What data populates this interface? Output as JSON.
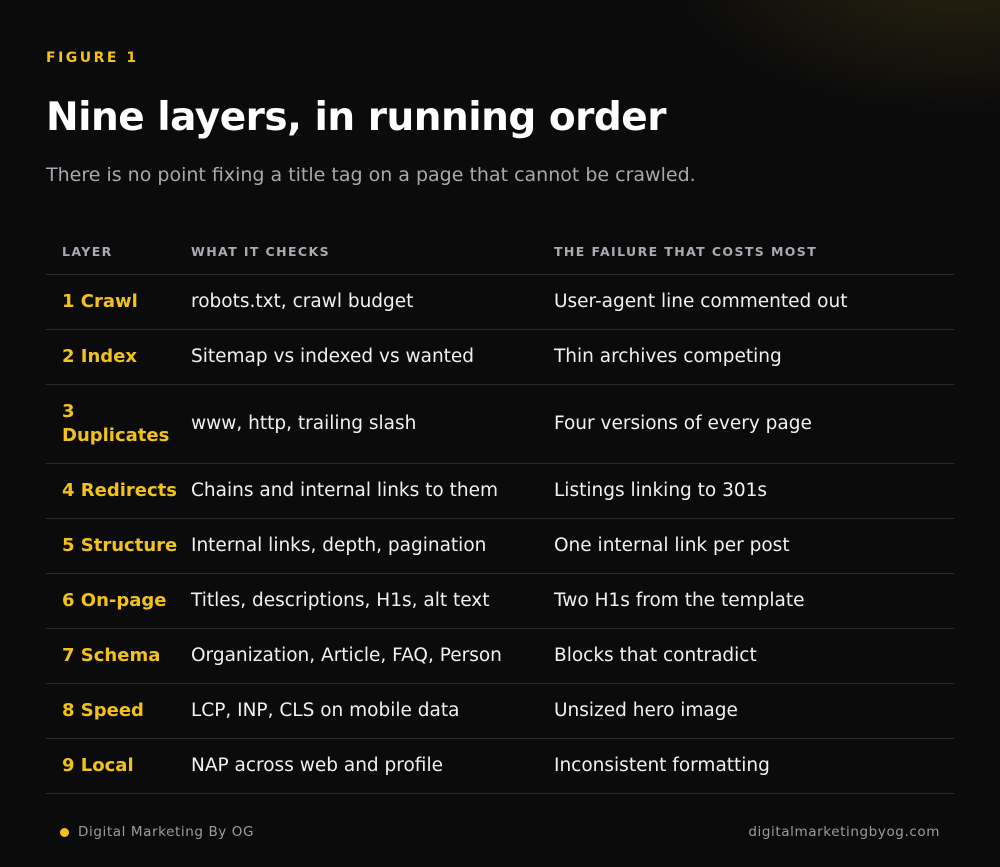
{
  "figure_label": "FIGURE 1",
  "title": "Nine layers, in running order",
  "subtitle": "There is no point fixing a title tag on a page that cannot be crawled.",
  "colors": {
    "accent": "#f2c21b",
    "background": "#0b0b0c",
    "muted_text": "#a6a9b0",
    "divider": "#2a2a2e"
  },
  "table": {
    "headers": [
      "LAYER",
      "WHAT IT CHECKS",
      "THE FAILURE THAT COSTS MOST"
    ],
    "rows": [
      {
        "layer": "1 Crawl",
        "checks": "robots.txt, crawl budget",
        "failure": "User-agent line commented out"
      },
      {
        "layer": "2 Index",
        "checks": "Sitemap vs indexed vs wanted",
        "failure": "Thin archives competing"
      },
      {
        "layer": "3 Duplicates",
        "checks": "www, http, trailing slash",
        "failure": "Four versions of every page"
      },
      {
        "layer": "4 Redirects",
        "checks": "Chains and internal links to them",
        "failure": "Listings linking to 301s"
      },
      {
        "layer": "5 Structure",
        "checks": "Internal links, depth, pagination",
        "failure": "One internal link per post"
      },
      {
        "layer": "6 On-page",
        "checks": "Titles, descriptions, H1s, alt text",
        "failure": "Two H1s from the template"
      },
      {
        "layer": "7 Schema",
        "checks": "Organization, Article, FAQ, Person",
        "failure": "Blocks that contradict"
      },
      {
        "layer": "8 Speed",
        "checks": "LCP, INP, CLS on mobile data",
        "failure": "Unsized hero image"
      },
      {
        "layer": "9 Local",
        "checks": "NAP across web and profile",
        "failure": "Inconsistent formatting"
      }
    ]
  },
  "footer": {
    "brand": "Digital Marketing By OG",
    "url": "digitalmarketingbyog.com"
  }
}
